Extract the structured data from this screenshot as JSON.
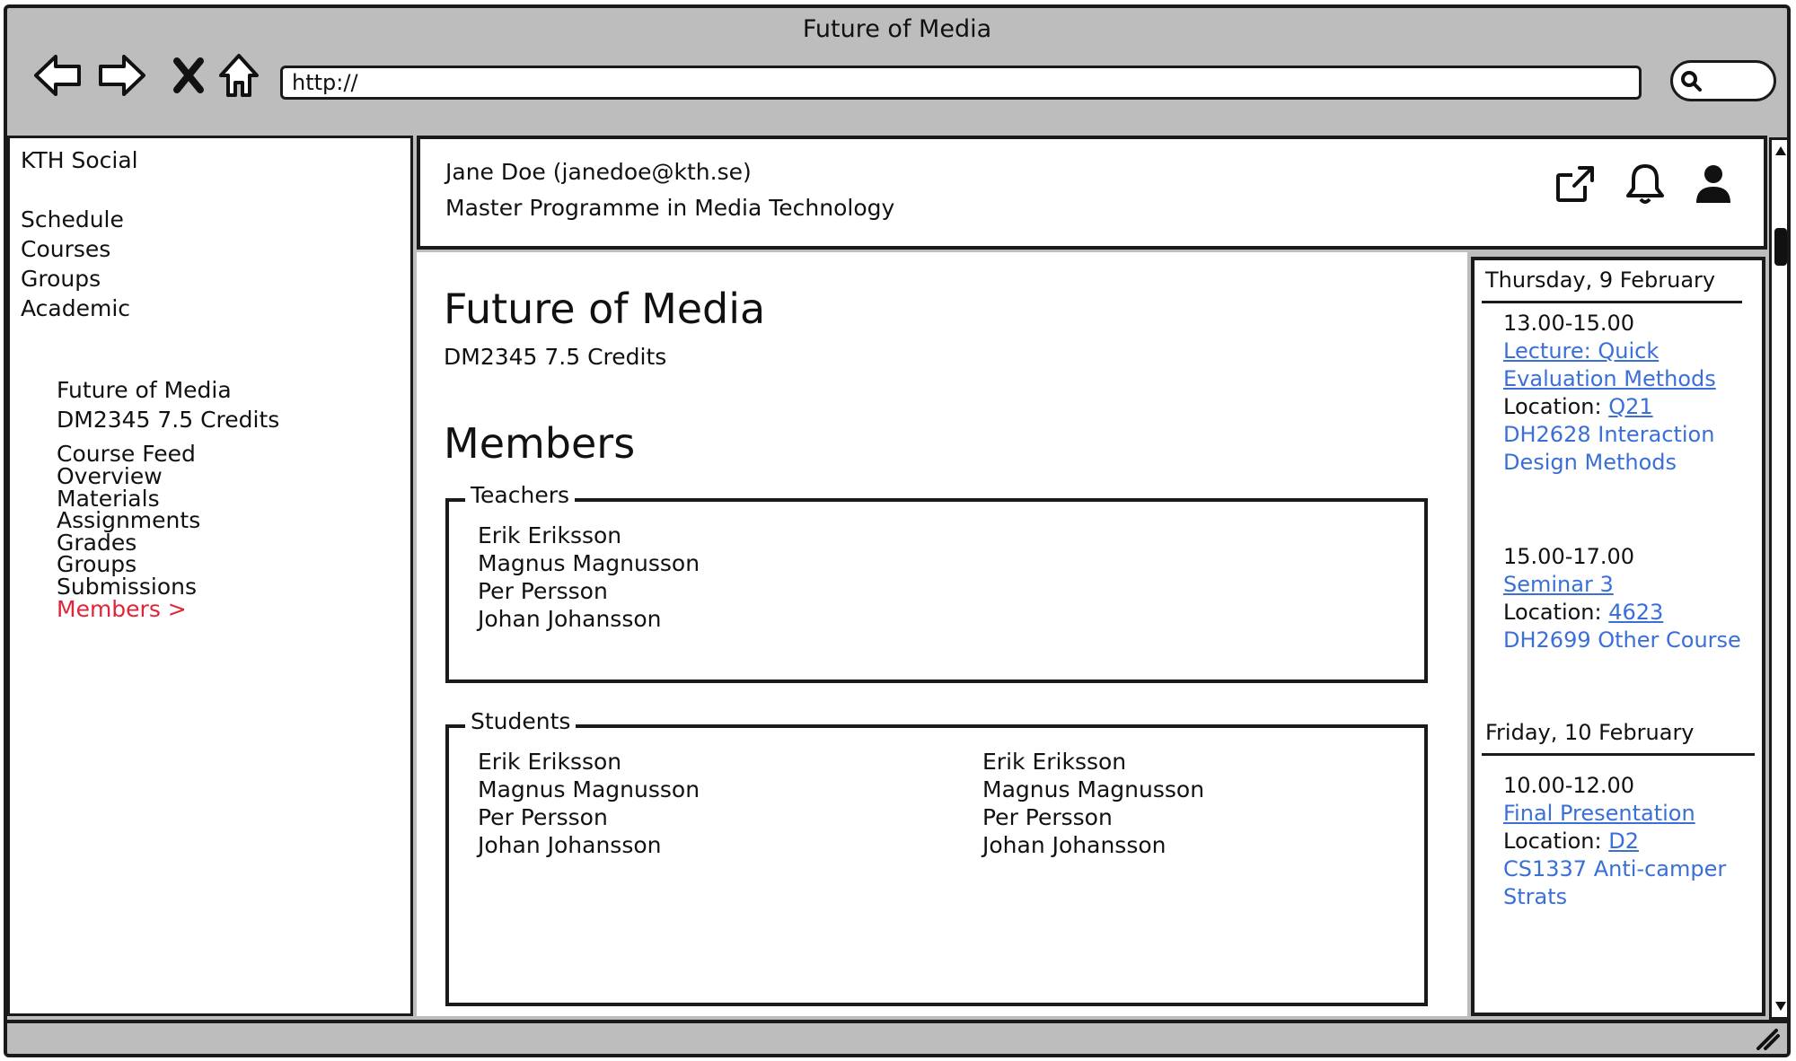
{
  "window": {
    "title": "Future of Media"
  },
  "browser": {
    "url": "http://"
  },
  "sidebar": {
    "app_name": "KTH Social",
    "nav": [
      "Schedule",
      "Courses",
      "Groups",
      "Academic"
    ],
    "course_title": "Future of Media",
    "course_code": "DM2345 7.5 Credits",
    "course_nav": [
      "Course Feed",
      "Overview",
      "Materials",
      "Assignments",
      "Grades",
      "Groups",
      "Submissions"
    ],
    "active_item": "Members >",
    "active_color": "#e0243a"
  },
  "header": {
    "user": "Jane Doe (janedoe@kth.se)",
    "programme": "Master Programme in Media Technology",
    "icons": [
      "external-link-icon",
      "bell-icon",
      "user-icon"
    ]
  },
  "main": {
    "title": "Future of Media",
    "subtitle": "DM2345 7.5 Credits",
    "members_heading": "Members",
    "teachers": {
      "label": "Teachers",
      "names": [
        "Erik Eriksson",
        "Magnus Magnusson",
        "Per Persson",
        "Johan Johansson"
      ]
    },
    "students": {
      "label": "Students",
      "col1": [
        "Erik Eriksson",
        "Magnus Magnusson",
        "Per Persson",
        "Johan Johansson"
      ],
      "col2": [
        "Erik Eriksson",
        "Magnus Magnusson",
        "Per Persson",
        "Johan Johansson"
      ]
    }
  },
  "schedule": {
    "link_color": "#3a6fd8",
    "days": [
      {
        "date": "Thursday, 9 February",
        "events": [
          {
            "time": "13.00-15.00",
            "title_l1": "Lecture: Quick",
            "title_l2": "Evaluation Methods",
            "location_label": "Location:",
            "location": "Q21",
            "course_l1": "DH2628 Interaction",
            "course_l2": "Design Methods"
          },
          {
            "time": "15.00-17.00",
            "title_l1": "Seminar 3",
            "location_label": "Location:",
            "location": "4623",
            "course_l1": "DH2699 Other Course"
          }
        ]
      },
      {
        "date": "Friday, 10 February",
        "events": [
          {
            "time": "10.00-12.00",
            "title_l1": "Final Presentation",
            "location_label": "Location:",
            "location": "D2",
            "course_l1": "CS1337 Anti-camper",
            "course_l2": "Strats"
          }
        ]
      }
    ]
  }
}
